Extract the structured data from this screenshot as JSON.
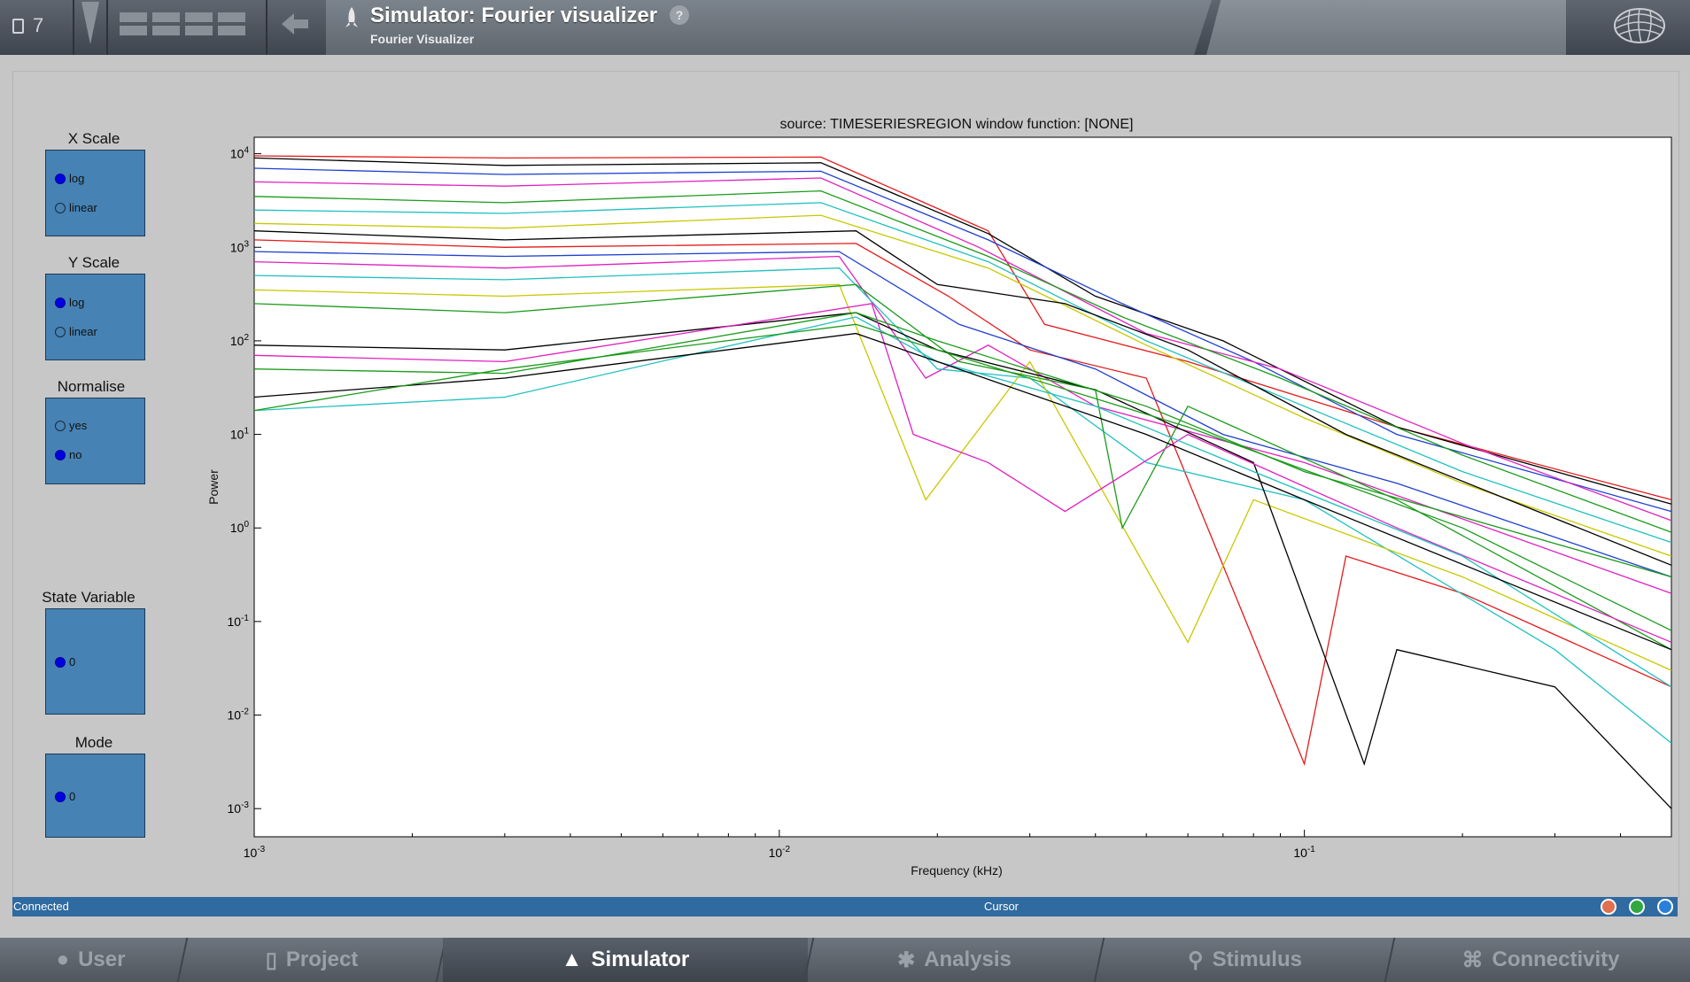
{
  "header": {
    "project_count": "7",
    "title": "Simulator: Fourier visualizer",
    "subtitle": "Fourier Visualizer",
    "help_label": "?"
  },
  "controls": {
    "x_scale": {
      "label": "X Scale",
      "options": [
        "log",
        "linear"
      ],
      "selected": "log"
    },
    "y_scale": {
      "label": "Y Scale",
      "options": [
        "log",
        "linear"
      ],
      "selected": "log"
    },
    "normalise": {
      "label": "Normalise",
      "options": [
        "yes",
        "no"
      ],
      "selected": "no"
    },
    "state_variable": {
      "label": "State Variable",
      "options": [
        "0"
      ],
      "selected": "0"
    },
    "mode": {
      "label": "Mode",
      "options": [
        "0"
      ],
      "selected": "0"
    }
  },
  "chart_data": {
    "type": "line",
    "title": "source: TIMESERIESREGION  window function: [NONE]",
    "xlabel": "Frequency (kHz)",
    "ylabel": "Power",
    "x_scale": "log",
    "y_scale": "log",
    "xlim": [
      0.001,
      0.5
    ],
    "ylim": [
      0.0005,
      15000
    ],
    "x_ticks": [
      "10-3",
      "10-2",
      "10-1"
    ],
    "y_ticks": [
      "10-3",
      "10-2",
      "10-1",
      "100",
      "101",
      "102",
      "103",
      "104"
    ],
    "grid": false,
    "series_note_colors": [
      "#e41a1c",
      "#000000",
      "#1f3fd0",
      "#1a9b1a",
      "#e020c0",
      "#20c0c0",
      "#c8c800",
      "#2f2f7f"
    ],
    "series": [
      {
        "color": "#e41a1c",
        "values": [
          [
            0.001,
            9500
          ],
          [
            0.003,
            9000
          ],
          [
            0.012,
            9200
          ],
          [
            0.025,
            1500
          ],
          [
            0.032,
            150
          ],
          [
            0.06,
            60
          ],
          [
            0.15,
            12
          ],
          [
            0.5,
            2.0
          ]
        ]
      },
      {
        "color": "#000000",
        "values": [
          [
            0.001,
            9000
          ],
          [
            0.003,
            7500
          ],
          [
            0.012,
            8000
          ],
          [
            0.025,
            1400
          ],
          [
            0.04,
            300
          ],
          [
            0.07,
            100
          ],
          [
            0.15,
            12
          ],
          [
            0.5,
            1.8
          ]
        ]
      },
      {
        "color": "#1f3fd0",
        "values": [
          [
            0.001,
            7000
          ],
          [
            0.003,
            6000
          ],
          [
            0.012,
            6500
          ],
          [
            0.025,
            1200
          ],
          [
            0.045,
            250
          ],
          [
            0.08,
            60
          ],
          [
            0.15,
            10
          ],
          [
            0.5,
            1.5
          ]
        ]
      },
      {
        "color": "#e020c0",
        "values": [
          [
            0.001,
            5000
          ],
          [
            0.003,
            4500
          ],
          [
            0.012,
            5500
          ],
          [
            0.024,
            1000
          ],
          [
            0.05,
            120
          ],
          [
            0.09,
            50
          ],
          [
            0.2,
            8
          ],
          [
            0.5,
            1.2
          ]
        ]
      },
      {
        "color": "#1a9b1a",
        "values": [
          [
            0.001,
            3500
          ],
          [
            0.003,
            3000
          ],
          [
            0.012,
            4000
          ],
          [
            0.025,
            800
          ],
          [
            0.045,
            180
          ],
          [
            0.09,
            40
          ],
          [
            0.2,
            6
          ],
          [
            0.5,
            0.9
          ]
        ]
      },
      {
        "color": "#20c0c0",
        "values": [
          [
            0.001,
            2500
          ],
          [
            0.003,
            2300
          ],
          [
            0.012,
            3000
          ],
          [
            0.025,
            700
          ],
          [
            0.05,
            100
          ],
          [
            0.1,
            20
          ],
          [
            0.2,
            4
          ],
          [
            0.5,
            0.7
          ]
        ]
      },
      {
        "color": "#c8c800",
        "values": [
          [
            0.001,
            1800
          ],
          [
            0.003,
            1600
          ],
          [
            0.012,
            2200
          ],
          [
            0.025,
            600
          ],
          [
            0.05,
            90
          ],
          [
            0.1,
            15
          ],
          [
            0.2,
            3
          ],
          [
            0.5,
            0.5
          ]
        ]
      },
      {
        "color": "#000000",
        "values": [
          [
            0.001,
            1500
          ],
          [
            0.003,
            1200
          ],
          [
            0.014,
            1500
          ],
          [
            0.02,
            400
          ],
          [
            0.035,
            250
          ],
          [
            0.06,
            80
          ],
          [
            0.12,
            10
          ],
          [
            0.5,
            0.4
          ]
        ]
      },
      {
        "color": "#e41a1c",
        "values": [
          [
            0.001,
            1200
          ],
          [
            0.003,
            1000
          ],
          [
            0.014,
            1100
          ],
          [
            0.021,
            300
          ],
          [
            0.03,
            80
          ],
          [
            0.05,
            40
          ],
          [
            0.1,
            0.003
          ],
          [
            0.12,
            0.5
          ],
          [
            0.2,
            0.2
          ],
          [
            0.5,
            0.02
          ]
        ]
      },
      {
        "color": "#1f3fd0",
        "values": [
          [
            0.001,
            900
          ],
          [
            0.003,
            800
          ],
          [
            0.013,
            900
          ],
          [
            0.022,
            150
          ],
          [
            0.04,
            50
          ],
          [
            0.07,
            10
          ],
          [
            0.15,
            3
          ],
          [
            0.5,
            0.3
          ]
        ]
      },
      {
        "color": "#e020c0",
        "values": [
          [
            0.001,
            700
          ],
          [
            0.003,
            600
          ],
          [
            0.013,
            800
          ],
          [
            0.019,
            40
          ],
          [
            0.025,
            90
          ],
          [
            0.04,
            20
          ],
          [
            0.1,
            5
          ],
          [
            0.5,
            0.2
          ]
        ]
      },
      {
        "color": "#20c0c0",
        "values": [
          [
            0.001,
            500
          ],
          [
            0.003,
            450
          ],
          [
            0.013,
            600
          ],
          [
            0.02,
            50
          ],
          [
            0.03,
            40
          ],
          [
            0.05,
            5
          ],
          [
            0.1,
            2
          ],
          [
            0.3,
            0.05
          ],
          [
            0.5,
            0.005
          ]
        ]
      },
      {
        "color": "#c8c800",
        "values": [
          [
            0.001,
            350
          ],
          [
            0.003,
            300
          ],
          [
            0.013,
            400
          ],
          [
            0.019,
            2.0
          ],
          [
            0.03,
            60
          ],
          [
            0.06,
            0.06
          ],
          [
            0.08,
            2
          ],
          [
            0.2,
            0.3
          ],
          [
            0.5,
            0.03
          ]
        ]
      },
      {
        "color": "#1a9b1a",
        "values": [
          [
            0.001,
            250
          ],
          [
            0.003,
            200
          ],
          [
            0.014,
            400
          ],
          [
            0.022,
            60
          ],
          [
            0.04,
            30
          ],
          [
            0.045,
            1.0
          ],
          [
            0.06,
            20
          ],
          [
            0.15,
            2
          ],
          [
            0.5,
            0.05
          ]
        ]
      },
      {
        "color": "#000000",
        "values": [
          [
            0.001,
            90
          ],
          [
            0.003,
            80
          ],
          [
            0.014,
            200
          ],
          [
            0.02,
            80
          ],
          [
            0.04,
            30
          ],
          [
            0.08,
            5
          ],
          [
            0.13,
            0.003
          ],
          [
            0.15,
            0.05
          ],
          [
            0.3,
            0.02
          ],
          [
            0.5,
            0.001
          ]
        ]
      },
      {
        "color": "#e020c0",
        "values": [
          [
            0.001,
            70
          ],
          [
            0.003,
            60
          ],
          [
            0.015,
            250
          ],
          [
            0.018,
            10
          ],
          [
            0.025,
            5
          ],
          [
            0.035,
            1.5
          ],
          [
            0.06,
            10
          ],
          [
            0.15,
            1
          ],
          [
            0.5,
            0.06
          ]
        ]
      },
      {
        "color": "#1a9b1a",
        "values": [
          [
            0.001,
            50
          ],
          [
            0.003,
            45
          ],
          [
            0.014,
            200
          ],
          [
            0.02,
            100
          ],
          [
            0.05,
            20
          ],
          [
            0.1,
            4
          ],
          [
            0.5,
            0.3
          ]
        ]
      },
      {
        "color": "#20c0c0",
        "values": [
          [
            0.001,
            18
          ],
          [
            0.003,
            25
          ],
          [
            0.014,
            180
          ],
          [
            0.02,
            60
          ],
          [
            0.04,
            20
          ],
          [
            0.08,
            4
          ],
          [
            0.2,
            0.5
          ],
          [
            0.5,
            0.02
          ]
        ]
      },
      {
        "color": "#000000",
        "values": [
          [
            0.001,
            25
          ],
          [
            0.003,
            40
          ],
          [
            0.014,
            120
          ],
          [
            0.02,
            60
          ],
          [
            0.05,
            10
          ],
          [
            0.1,
            2
          ],
          [
            0.5,
            0.05
          ]
        ]
      },
      {
        "color": "#1a9b1a",
        "values": [
          [
            0.001,
            18
          ],
          [
            0.003,
            50
          ],
          [
            0.014,
            150
          ],
          [
            0.02,
            80
          ],
          [
            0.06,
            12
          ],
          [
            0.2,
            1
          ],
          [
            0.5,
            0.08
          ]
        ]
      }
    ]
  },
  "statusbar": {
    "status": "Connected",
    "cursor": "Cursor"
  },
  "nav": {
    "tabs": [
      {
        "label": "User",
        "icon": "user-icon"
      },
      {
        "label": "Project",
        "icon": "document-icon"
      },
      {
        "label": "Simulator",
        "icon": "rocket-icon"
      },
      {
        "label": "Analysis",
        "icon": "gear-icon"
      },
      {
        "label": "Stimulus",
        "icon": "pin-icon"
      },
      {
        "label": "Connectivity",
        "icon": "network-icon"
      }
    ],
    "active": "Simulator"
  },
  "colors": {
    "accent": "#4682b4",
    "statusbar": "#2f6aa0",
    "radio_selected": "#0000e0"
  }
}
